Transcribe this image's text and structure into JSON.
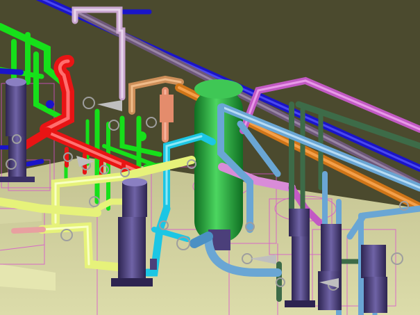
{
  "scene": {
    "kind": "3d-piping-plant-render",
    "colors": {
      "background": "#4b4a2e",
      "floor": "#cfcf9c",
      "blue_pipe": "#1a14c8",
      "purple_pipe": "#6e587a",
      "orange_pipe": "#d07518",
      "light_blue_pipe": "#6aa6d4",
      "magenta_pipe": "#c25ac4",
      "dark_green_pipe": "#3d6b48",
      "green_pipe": "#16e01a",
      "red_pipe": "#e81414",
      "yellow_pipe": "#e6f27a",
      "cyan_pipe": "#1cc6e4",
      "pink_pipe": "#e8a0a0",
      "lavender_pipe": "#c9a6cf",
      "tan_pipe": "#cc8e58",
      "salmon_pipe": "#e48c6c",
      "pump": "#4b3f7a",
      "vessel": "#24a83c",
      "valve": "#9e9e9e",
      "wireframe": "#d84fd0"
    }
  }
}
